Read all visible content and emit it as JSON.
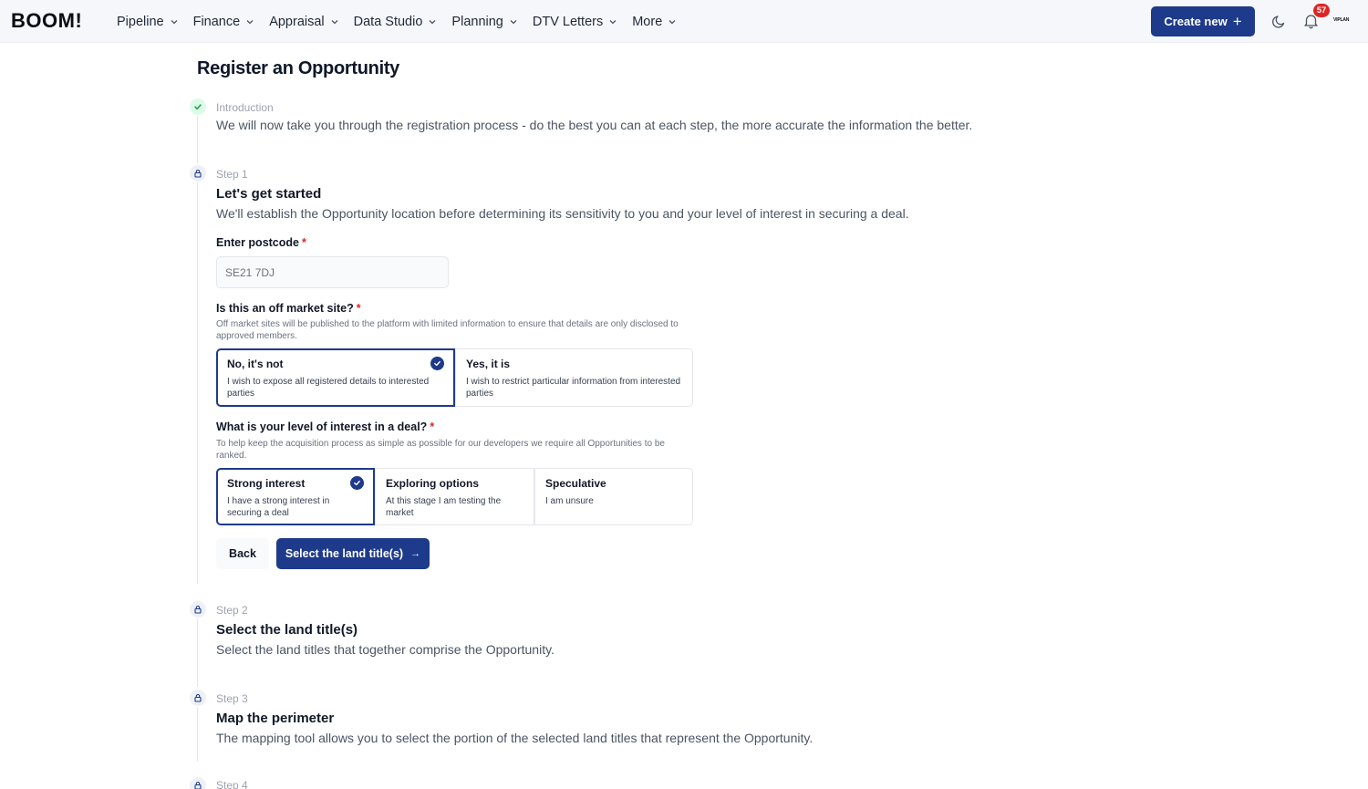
{
  "header": {
    "logo": "BOOM!",
    "nav": [
      {
        "label": "Pipeline"
      },
      {
        "label": "Finance"
      },
      {
        "label": "Appraisal"
      },
      {
        "label": "Data Studio"
      },
      {
        "label": "Planning"
      },
      {
        "label": "DTV Letters"
      },
      {
        "label": "More"
      }
    ],
    "create_label": "Create new",
    "notifications_count": "57",
    "avatar_text": "VIPLAN"
  },
  "page": {
    "title": "Register an Opportunity"
  },
  "intro": {
    "label": "Introduction",
    "desc": "We will now take you through the registration process - do the best you can at each step, the more accurate the information the better."
  },
  "step1": {
    "label": "Step 1",
    "title": "Let's get started",
    "desc": "We'll establish the Opportunity location before determining its sensitivity to you and your level of interest in securing a deal.",
    "postcode": {
      "label": "Enter postcode",
      "required": "*",
      "value": "SE21 7DJ"
    },
    "off_market": {
      "label": "Is this an off market site?",
      "required": "*",
      "help": "Off market sites will be published to the platform with limited information to ensure that details are only disclosed to approved members.",
      "options": [
        {
          "title": "No, it's not",
          "desc": "I wish to expose all registered details to interested parties"
        },
        {
          "title": "Yes, it is",
          "desc": "I wish to restrict particular information from interested parties"
        }
      ],
      "selected": "No, it's not"
    },
    "interest": {
      "label": "What is your level of interest in a deal?",
      "required": "*",
      "help": "To help keep the acquisition process as simple as possible for our developers we require all Opportunities to be ranked.",
      "options": [
        {
          "title": "Strong interest",
          "desc": "I have a strong interest in securing a deal"
        },
        {
          "title": "Exploring options",
          "desc": "At this stage I am testing the market"
        },
        {
          "title": "Speculative",
          "desc": "I am unsure"
        }
      ],
      "selected": "Strong interest"
    },
    "back_label": "Back",
    "next_label": "Select the land title(s)",
    "next_arrow": "→"
  },
  "step2": {
    "label": "Step 2",
    "title": "Select the land title(s)",
    "desc": "Select the land titles that together comprise the Opportunity."
  },
  "step3": {
    "label": "Step 3",
    "title": "Map the perimeter",
    "desc": "The mapping tool allows you to select the portion of the selected land titles that represent the Opportunity."
  },
  "step4": {
    "label": "Step 4"
  },
  "colors": {
    "primary": "#1e3a8a",
    "success_bg": "#dcfce7",
    "badge": "#dc2626"
  }
}
